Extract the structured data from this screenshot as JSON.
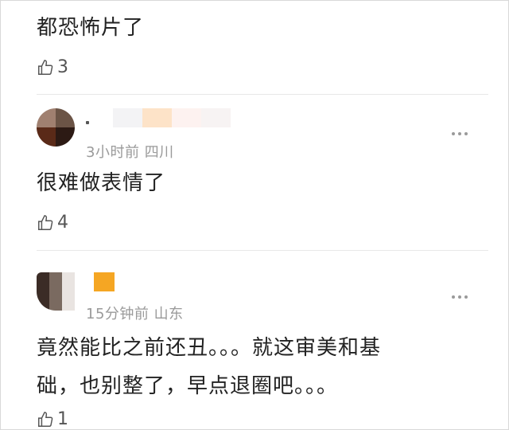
{
  "comments": [
    {
      "text": "都恐怖片了",
      "likes": "3"
    },
    {
      "time": "3小时前",
      "location": "四川",
      "text": "很难做表情了",
      "likes": "4"
    },
    {
      "time": "15分钟前",
      "location": "山东",
      "text_line1": "竟然能比之前还丑。。。就这审美和基",
      "text_line2": "础，也别整了，早点退圈吧。。。",
      "likes": "1"
    }
  ]
}
